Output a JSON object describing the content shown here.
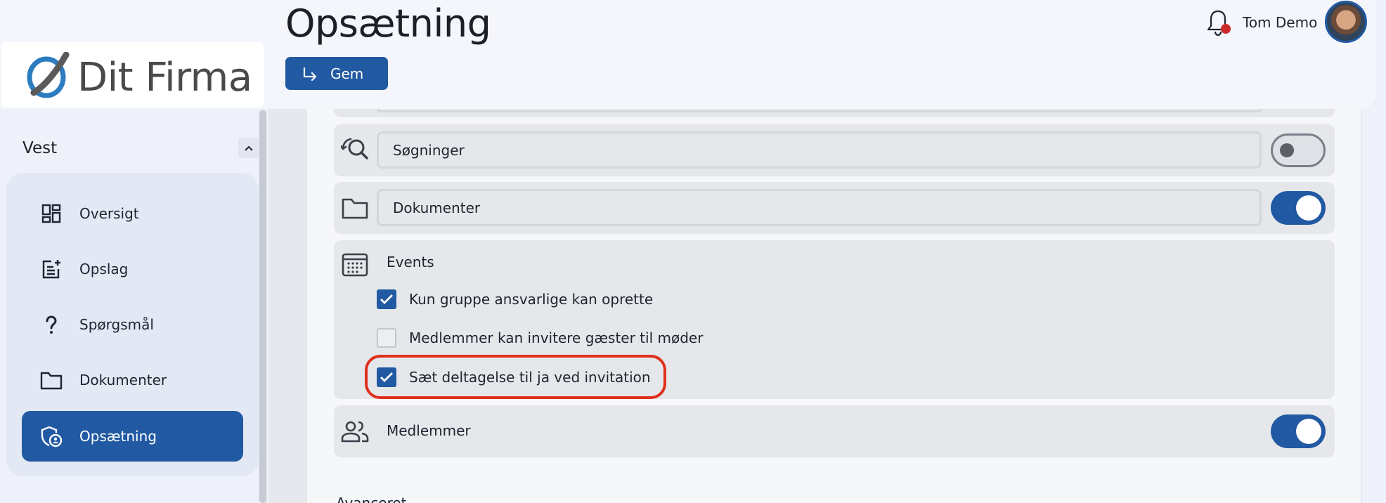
{
  "header": {
    "page_title": "Opsætning",
    "save_label": "Gem",
    "user_name": "Tom Demo"
  },
  "logo": {
    "text": "Dit Firma"
  },
  "sidebar": {
    "group_title": "Vest",
    "items": [
      {
        "label": "Oversigt",
        "icon": "dashboard-icon",
        "active": false
      },
      {
        "label": "Opslag",
        "icon": "post-add-icon",
        "active": false
      },
      {
        "label": "Spørgsmål",
        "icon": "question-icon",
        "active": false
      },
      {
        "label": "Dokumenter",
        "icon": "folder-icon",
        "active": false
      },
      {
        "label": "Opsætning",
        "icon": "admin-shield-icon",
        "active": true
      }
    ]
  },
  "settings": {
    "searches": {
      "label": "Søgninger",
      "enabled": false,
      "icon": "manage-search-icon"
    },
    "documents": {
      "label": "Dokumenter",
      "enabled": true,
      "icon": "folder-icon"
    },
    "events": {
      "label": "Events",
      "icon": "calendar-icon",
      "options": [
        {
          "label": "Kun gruppe ansvarlige kan oprette",
          "checked": true
        },
        {
          "label": "Medlemmer kan invitere gæster til møder",
          "checked": false
        },
        {
          "label": "Sæt deltagelse til ja ved invitation",
          "checked": true
        }
      ]
    },
    "members": {
      "label": "Medlemmer",
      "enabled": true,
      "icon": "people-icon"
    }
  },
  "colors": {
    "primary": "#2159a2",
    "highlight": "#e0301e",
    "notification_dot": "#cc2b2b"
  }
}
